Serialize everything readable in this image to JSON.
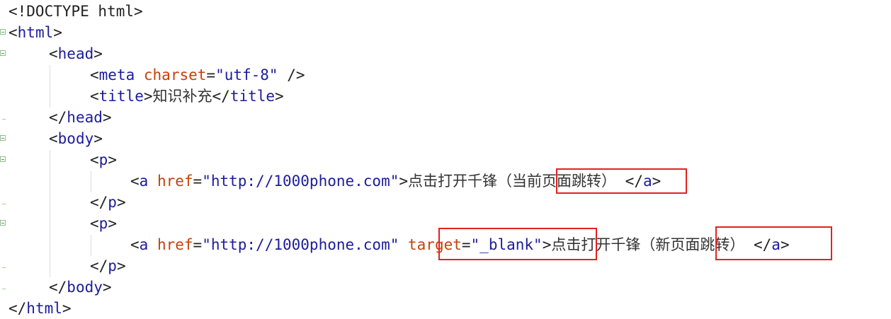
{
  "code": {
    "doctype": "<!DOCTYPE html>",
    "html_open": "html",
    "head": "head",
    "meta": "meta",
    "charset_attr": "charset",
    "charset_val": "\"utf-8\"",
    "meta_close": " />",
    "title": "title",
    "title_text": "知识补充",
    "body": "body",
    "p": "p",
    "a": "a",
    "href_attr": "href",
    "href_val": "\"http://1000phone.com\"",
    "link1_text": "点击打开千锋",
    "link1_note": "（当前页面跳转）",
    "target_attr": "target",
    "target_val": "\"_blank\"",
    "link2_text": "点击打开千锋",
    "link2_note": "（新页面跳转）"
  },
  "colors": {
    "tag": "#1c1c9c",
    "attribute": "#c5410c",
    "highlight": "#e0231f"
  }
}
